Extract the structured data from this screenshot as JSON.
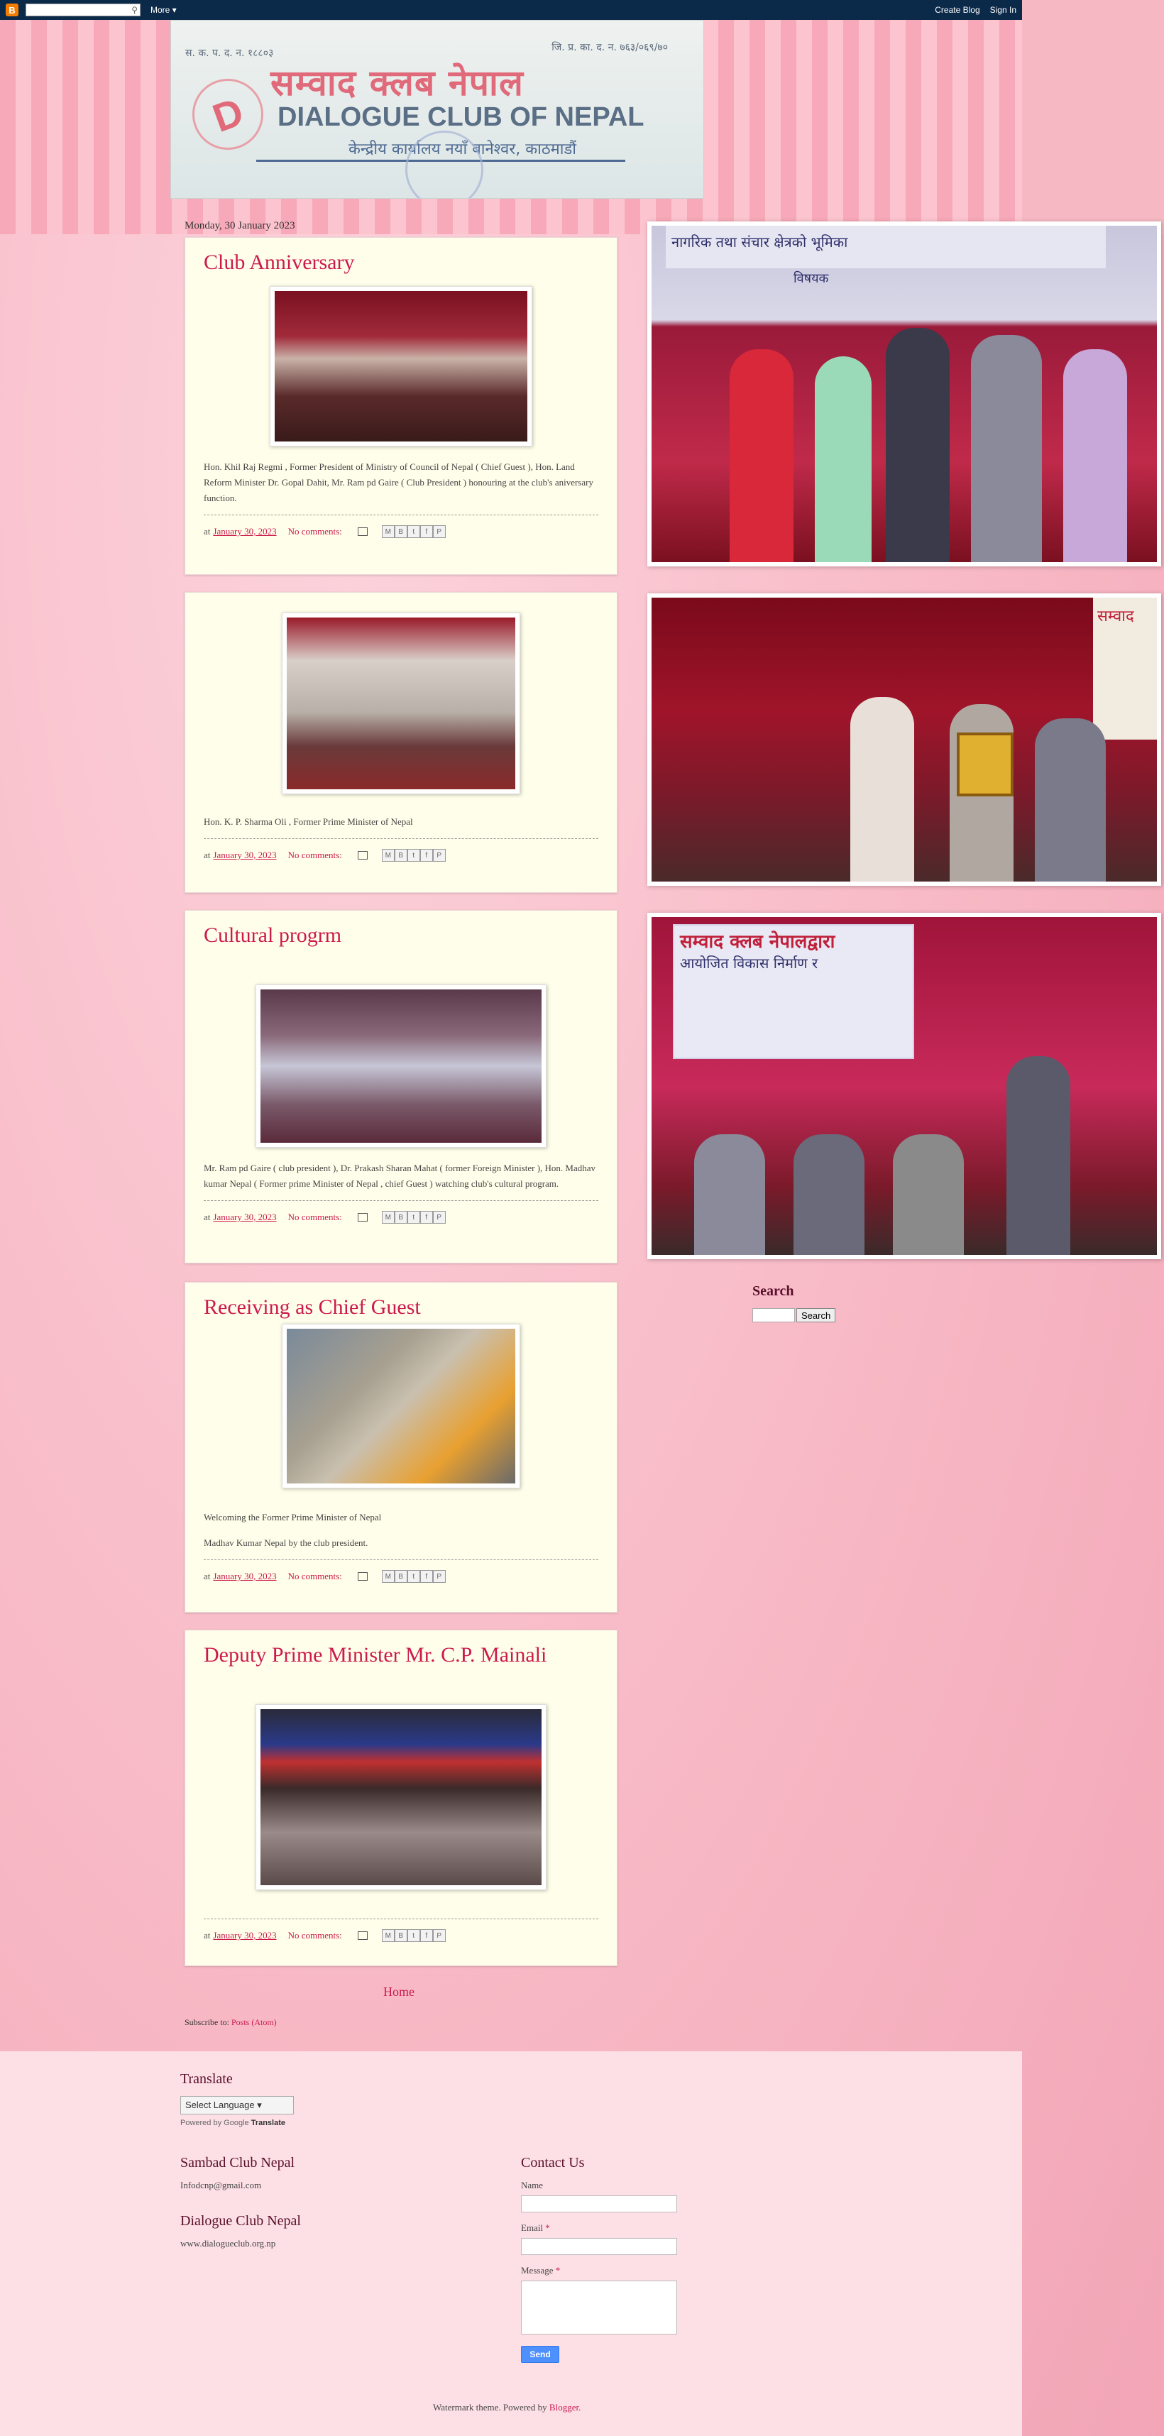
{
  "navbar": {
    "logo": "B",
    "more": "More ▾",
    "create_blog": "Create Blog",
    "sign_in": "Sign In"
  },
  "header": {
    "reg_left": "स. क. प. द. न. १८८०३",
    "reg_right": "जि. प्र. का. द. न. ७६३/०६९/७०",
    "title_nepali": "सम्वाद क्लब नेपाल",
    "title_english": "DIALOGUE CLUB OF NEPAL",
    "address": "केन्द्रीय कार्यालय नयाँ बानेश्वर, काठमाडौं"
  },
  "date_header": "Monday, 30 January 2023",
  "posts": [
    {
      "title": "Club Anniversary",
      "body": "Hon. Khil Raj Regmi , Former President of Ministry of Council of Nepal ( Chief Guest ), Hon. Land Reform Minister Dr. Gopal Dahit, Mr. Ram pd Gaire ( Club President ) honouring at the club's  aniversary function.",
      "at": "at",
      "date": "January 30, 2023",
      "comments": "No comments:"
    },
    {
      "title": "",
      "body": "Hon. K. P. Sharma Oli , Former Prime Minister of Nepal",
      "at": "at",
      "date": "January 30, 2023",
      "comments": "No comments:"
    },
    {
      "title": "Cultural progrm",
      "body": "Mr. Ram pd Gaire ( club president ), Dr. Prakash Sharan Mahat ( former Foreign Minister ), Hon. Madhav kumar Nepal ( Former prime Minister of Nepal , chief Guest ) watching club's cultural program.",
      "at": "at",
      "date": "January 30, 2023",
      "comments": "No comments:"
    },
    {
      "title": "Receiving as Chief Guest",
      "body": "Welcoming the Former Prime Minister of Nepal",
      "body2": "Madhav Kumar Nepal by the club president.",
      "at": "at",
      "date": "January 30, 2023",
      "comments": "No comments:"
    },
    {
      "title": "Deputy Prime Minister Mr. C.P. Mainali",
      "body": "",
      "at": "at",
      "date": "January 30, 2023",
      "comments": "No comments:"
    }
  ],
  "share_buttons": [
    "M",
    "B",
    "t",
    "f",
    "P"
  ],
  "sidebar": {
    "photo1_banner": "नागरिक तथा संचार क्षेत्रको भूमिका",
    "photo1_sub": "विषयक",
    "photo2_banner": "सम्वाद",
    "photo3_banner": "सम्वाद क्लब नेपालद्वारा",
    "photo3_sub": "आयोजित विकास निर्माण र",
    "search_title": "Search",
    "search_button": "Search"
  },
  "home_link": "Home",
  "subscribe": {
    "label": "Subscribe to:",
    "link": "Posts (Atom)"
  },
  "footer": {
    "translate_title": "Translate",
    "select_language": "Select Language",
    "powered_by": "Powered by",
    "google": "Google",
    "translate_word": "Translate",
    "sambad_title": "Sambad Club Nepal",
    "sambad_email": "Infodcnp@gmail.com",
    "dialogue_title": "Dialogue Club Nepal",
    "dialogue_url": "www.dialogueclub.org.np",
    "contact_title": "Contact Us",
    "name_label": "Name",
    "email_label": "Email",
    "message_label": "Message",
    "required": "*",
    "send": "Send",
    "attribution_text": "Watermark theme. Powered by",
    "attribution_link": "Blogger."
  },
  "colors": {
    "accent": "#cc1a4d",
    "navbar": "#0b2a4a",
    "post_bg": "#fffeea"
  }
}
